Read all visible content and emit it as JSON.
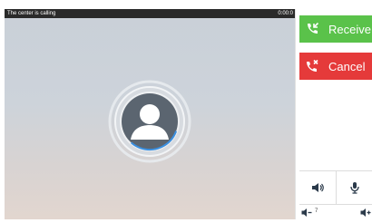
{
  "status": {
    "message": "The center is calling",
    "timer": "0:00:0"
  },
  "actions": {
    "receive_label": "Receive",
    "cancel_label": "Cancel"
  },
  "volume": {
    "level": "7"
  },
  "colors": {
    "receive": "#5ac24a",
    "cancel": "#e53a3a",
    "status_bar": "#2a2a2a"
  },
  "icons": {
    "receive": "phone-incoming-icon",
    "cancel": "phone-hangup-icon",
    "speaker": "speaker-icon",
    "mic": "microphone-icon",
    "volume_down": "volume-down-icon",
    "volume_up": "volume-up-icon",
    "avatar": "user-avatar-icon"
  }
}
